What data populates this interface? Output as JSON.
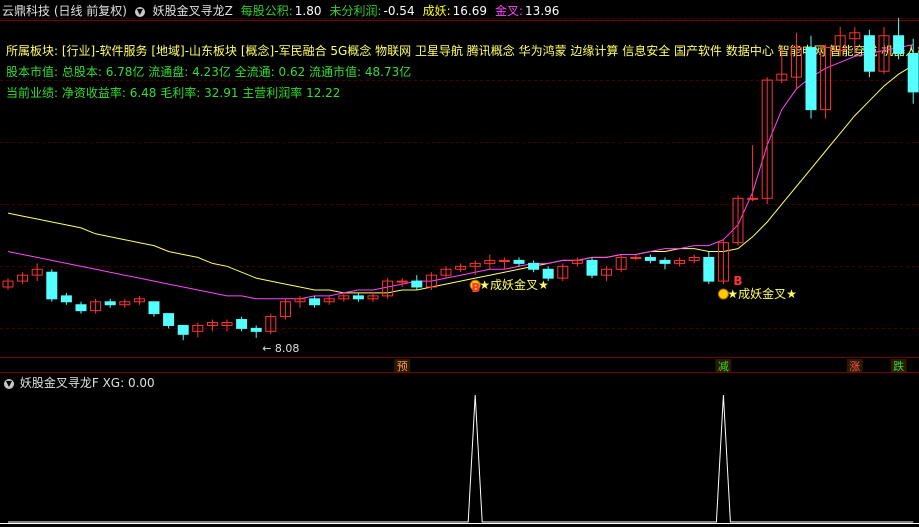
{
  "header": {
    "app_title": "云鼎科技 (日线 前复权)",
    "indicator_name": "妖股金叉寻龙Z",
    "items": [
      {
        "label": "每股公积:",
        "value": "1.80",
        "color": "#33cc33"
      },
      {
        "label": "未分利润:",
        "value": "-0.54",
        "color": "#33cc33"
      },
      {
        "label": "成妖:",
        "value": "16.69",
        "color": "#ffff00"
      },
      {
        "label": "金叉:",
        "value": "13.96",
        "color": "#ff44ff"
      }
    ]
  },
  "info": {
    "sector_line": "所属板块: [行业]-软件服务 [地域]-山东板块 [概念]-军民融合 5G概念 物联网 卫星导航 腾讯概念 华为鸿蒙 边缘计算 信息安全 国产软件 数据中心 智能电网 智能穿戴 机器人概念",
    "capital_line": "股本市值: 总股本: 6.78亿 流通盘: 4.23亿 全流通: 0.62 流通市值: 48.73亿",
    "performance_line": "当前业绩: 净资收益率: 6.48 毛利率: 32.91 主营利润率 12.22"
  },
  "chart_labels": {
    "low_price": "8.08",
    "signal_text": "成妖金叉",
    "star": "★",
    "signal_letter": "B",
    "ticks": [
      "预",
      "减",
      "涨",
      "跌"
    ]
  },
  "sub_panel": {
    "title": "妖股金叉寻龙F",
    "value_label": "XG: 0.00"
  },
  "colors": {
    "up": "#ff3333",
    "down": "#54ffff",
    "ma_yellow": "#ffff66",
    "ma_magenta": "#ff44ff",
    "grid": "#4a0000"
  },
  "chart_data": {
    "type": "candlestick",
    "x": [
      "1",
      "2",
      "3",
      "4",
      "5",
      "6",
      "7",
      "8",
      "9",
      "10",
      "11",
      "12",
      "13",
      "14",
      "15",
      "16",
      "17",
      "18",
      "19",
      "20",
      "21",
      "22",
      "23",
      "24",
      "25",
      "26",
      "27",
      "28",
      "29",
      "30",
      "31",
      "32",
      "33",
      "34",
      "35",
      "36",
      "37",
      "38",
      "39",
      "40",
      "41",
      "42",
      "43",
      "44",
      "45",
      "46",
      "47",
      "48",
      "49",
      "50",
      "51",
      "52",
      "53",
      "54",
      "55",
      "56",
      "57",
      "58",
      "59",
      "60",
      "61",
      "62",
      "63"
    ],
    "candles": [
      [
        9.8,
        10.1,
        9.7,
        10.0
      ],
      [
        10.0,
        10.3,
        9.9,
        10.2
      ],
      [
        10.2,
        10.6,
        10.0,
        10.4
      ],
      [
        10.3,
        10.4,
        9.3,
        9.4
      ],
      [
        9.5,
        9.6,
        9.2,
        9.3
      ],
      [
        9.2,
        9.3,
        8.9,
        9.0
      ],
      [
        9.0,
        9.4,
        8.9,
        9.3
      ],
      [
        9.3,
        9.4,
        9.1,
        9.2
      ],
      [
        9.2,
        9.4,
        9.1,
        9.3
      ],
      [
        9.3,
        9.5,
        9.2,
        9.4
      ],
      [
        9.3,
        9.3,
        8.8,
        8.9
      ],
      [
        8.9,
        8.9,
        8.4,
        8.5
      ],
      [
        8.5,
        8.5,
        8.0,
        8.2
      ],
      [
        8.3,
        8.6,
        8.1,
        8.5
      ],
      [
        8.5,
        8.7,
        8.3,
        8.6
      ],
      [
        8.5,
        8.7,
        8.3,
        8.6
      ],
      [
        8.7,
        8.8,
        8.3,
        8.4
      ],
      [
        8.4,
        8.5,
        8.08,
        8.3
      ],
      [
        8.3,
        8.9,
        8.2,
        8.8
      ],
      [
        8.8,
        9.4,
        8.7,
        9.3
      ],
      [
        9.3,
        9.5,
        9.1,
        9.4
      ],
      [
        9.4,
        9.5,
        9.1,
        9.2
      ],
      [
        9.3,
        9.5,
        9.2,
        9.4
      ],
      [
        9.4,
        9.6,
        9.3,
        9.5
      ],
      [
        9.5,
        9.6,
        9.3,
        9.4
      ],
      [
        9.4,
        9.6,
        9.3,
        9.5
      ],
      [
        9.5,
        10.1,
        9.4,
        10.0
      ],
      [
        10.0,
        10.1,
        9.8,
        10.0
      ],
      [
        10.0,
        10.2,
        9.7,
        9.8
      ],
      [
        9.8,
        10.3,
        9.7,
        10.2
      ],
      [
        10.2,
        10.5,
        10.1,
        10.4
      ],
      [
        10.4,
        10.6,
        10.3,
        10.5
      ],
      [
        10.5,
        10.7,
        10.2,
        10.6
      ],
      [
        10.6,
        10.9,
        10.4,
        10.7
      ],
      [
        10.7,
        10.8,
        10.4,
        10.7
      ],
      [
        10.7,
        10.8,
        10.5,
        10.6
      ],
      [
        10.6,
        10.7,
        10.3,
        10.4
      ],
      [
        10.4,
        10.5,
        10.0,
        10.1
      ],
      [
        10.1,
        10.6,
        10.0,
        10.5
      ],
      [
        10.6,
        10.8,
        10.5,
        10.7
      ],
      [
        10.7,
        10.8,
        10.1,
        10.2
      ],
      [
        10.2,
        10.5,
        10.0,
        10.4
      ],
      [
        10.4,
        10.9,
        10.3,
        10.8
      ],
      [
        10.8,
        10.9,
        10.7,
        10.8
      ],
      [
        10.8,
        10.9,
        10.6,
        10.7
      ],
      [
        10.7,
        10.8,
        10.4,
        10.6
      ],
      [
        10.6,
        10.8,
        10.5,
        10.7
      ],
      [
        10.7,
        10.9,
        10.6,
        10.8
      ],
      [
        10.8,
        11.0,
        9.9,
        10.0
      ],
      [
        10.0,
        11.4,
        9.9,
        11.3
      ],
      [
        11.3,
        12.9,
        11.2,
        12.8
      ],
      [
        12.8,
        14.6,
        12.7,
        12.8
      ],
      [
        12.8,
        16.9,
        12.6,
        16.8
      ],
      [
        16.8,
        17.9,
        16.7,
        17.0
      ],
      [
        16.9,
        18.4,
        16.5,
        17.9
      ],
      [
        17.9,
        18.3,
        15.5,
        15.8
      ],
      [
        15.8,
        18.0,
        15.5,
        17.9
      ],
      [
        17.8,
        18.6,
        17.6,
        18.3
      ],
      [
        18.2,
        18.6,
        17.7,
        18.4
      ],
      [
        18.3,
        18.5,
        16.9,
        17.1
      ],
      [
        17.1,
        18.6,
        17.0,
        18.3
      ],
      [
        18.3,
        18.9,
        17.5,
        17.7
      ],
      [
        17.7,
        18.2,
        16.0,
        16.4
      ]
    ],
    "ma_yellow": [
      12.3,
      12.2,
      12.1,
      12.0,
      11.9,
      11.8,
      11.6,
      11.5,
      11.4,
      11.3,
      11.2,
      11.0,
      10.9,
      10.8,
      10.6,
      10.5,
      10.3,
      10.1,
      10.0,
      9.9,
      9.8,
      9.7,
      9.7,
      9.6,
      9.6,
      9.6,
      9.6,
      9.7,
      9.7,
      9.8,
      9.9,
      10.0,
      10.1,
      10.2,
      10.3,
      10.4,
      10.5,
      10.6,
      10.7,
      10.7,
      10.8,
      10.8,
      10.9,
      10.9,
      11.0,
      11.0,
      11.1,
      11.1,
      11.0,
      11.0,
      11.1,
      11.5,
      12.0,
      12.6,
      13.2,
      13.8,
      14.4,
      15.0,
      15.6,
      16.1,
      16.6,
      17.0,
      17.3
    ],
    "ma_magenta": [
      11.0,
      10.9,
      10.8,
      10.7,
      10.6,
      10.5,
      10.4,
      10.3,
      10.2,
      10.1,
      10.0,
      9.9,
      9.8,
      9.7,
      9.6,
      9.5,
      9.5,
      9.4,
      9.4,
      9.4,
      9.4,
      9.5,
      9.5,
      9.6,
      9.7,
      9.7,
      9.8,
      9.9,
      10.0,
      10.0,
      10.1,
      10.2,
      10.3,
      10.4,
      10.4,
      10.5,
      10.6,
      10.6,
      10.7,
      10.7,
      10.8,
      10.8,
      10.9,
      10.9,
      11.0,
      11.1,
      11.1,
      11.2,
      11.2,
      11.4,
      11.9,
      13.0,
      14.6,
      15.8,
      16.5,
      16.9,
      17.2,
      17.4,
      17.6,
      17.7,
      17.8,
      17.9,
      18.0
    ],
    "xg": [
      0,
      0,
      0,
      0,
      0,
      0,
      0,
      0,
      0,
      0,
      0,
      0,
      0,
      0,
      0,
      0,
      0,
      0,
      0,
      0,
      0,
      0,
      0,
      0,
      0,
      0,
      0,
      0,
      0,
      0,
      0,
      0,
      1,
      0,
      0,
      0,
      0,
      0,
      0,
      0,
      0,
      0,
      0,
      0,
      0,
      0,
      0,
      0,
      0,
      1,
      0,
      0,
      0,
      0,
      0,
      0,
      0,
      0,
      0,
      0,
      0,
      0,
      0
    ],
    "signals": [
      {
        "index": 32,
        "label": "成妖金叉"
      },
      {
        "index": 49,
        "label": "成妖金叉"
      }
    ],
    "low_marker": {
      "index": 17,
      "value": 8.08
    }
  }
}
